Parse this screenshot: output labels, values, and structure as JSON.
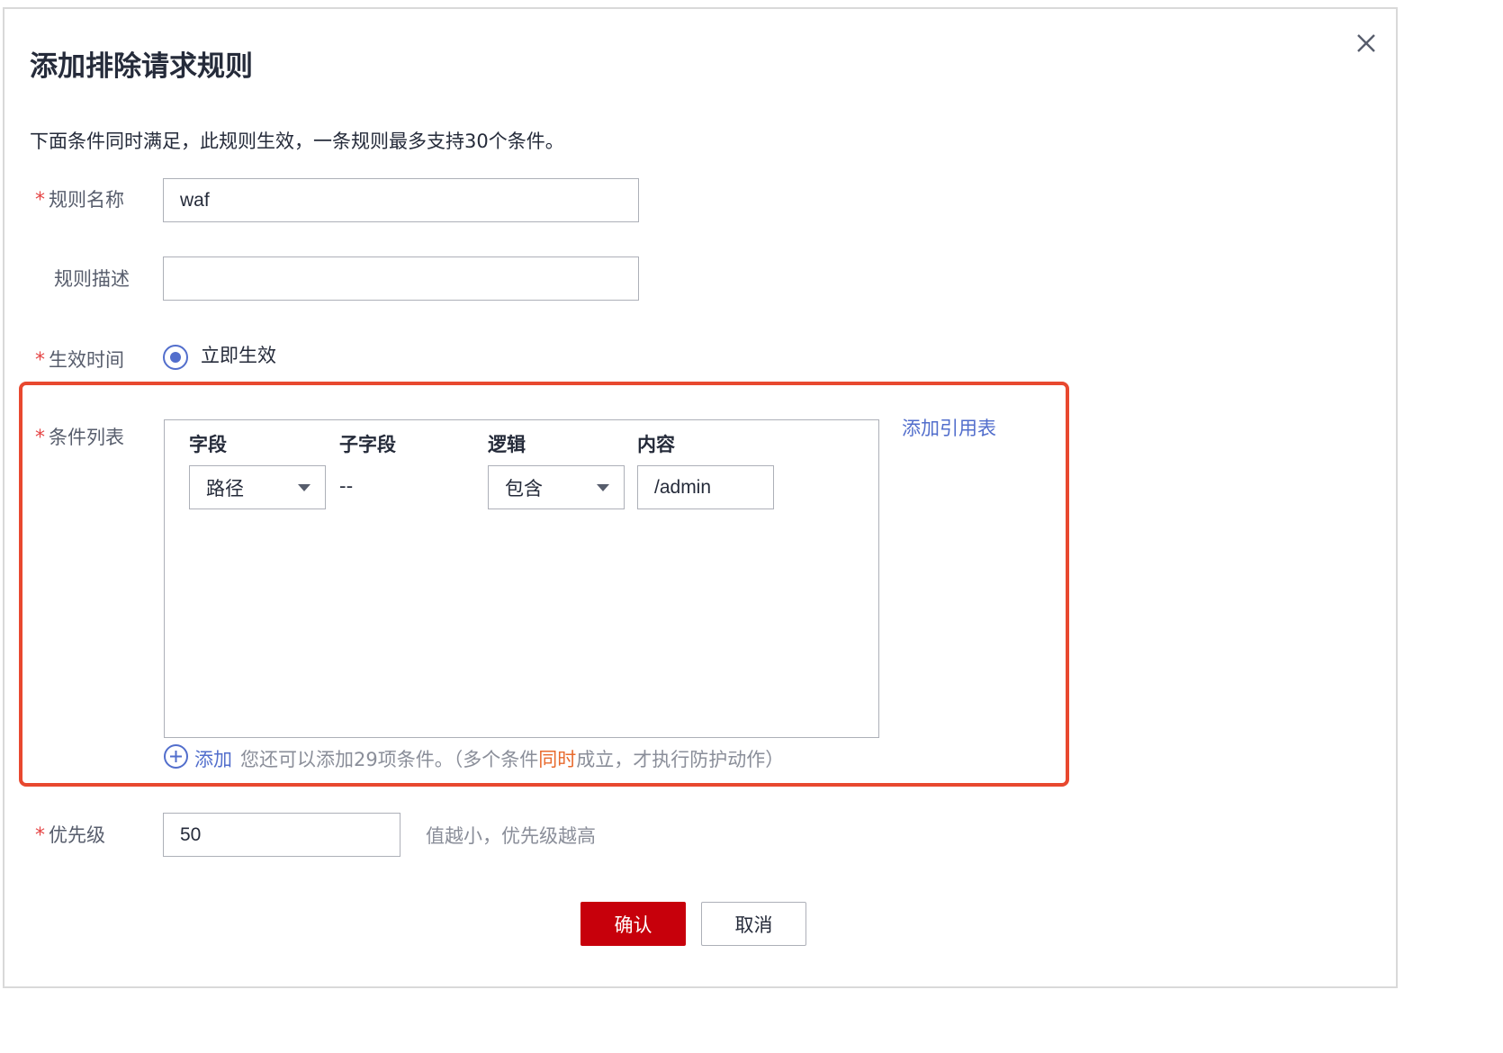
{
  "dialog": {
    "title": "添加排除请求规则",
    "description": "下面条件同时满足，此规则生效，一条规则最多支持30个条件。"
  },
  "form": {
    "required_mark": "*",
    "rule_name": {
      "label": "规则名称",
      "value": "waf"
    },
    "rule_desc": {
      "label": "规则描述",
      "value": ""
    },
    "effective_time": {
      "label": "生效时间",
      "option": "立即生效",
      "selected": true
    },
    "conditions": {
      "label": "条件列表",
      "add_reference_table": "添加引用表",
      "columns": [
        "字段",
        "子字段",
        "逻辑",
        "内容"
      ],
      "row": {
        "field": "路径",
        "subfield": "--",
        "logic": "包含",
        "content": "/admin"
      },
      "add_label": "添加",
      "add_hint_prefix": "您还可以添加29项条件。（多个条件",
      "add_hint_highlight": "同时",
      "add_hint_suffix": "成立，才执行防护动作）"
    },
    "priority": {
      "label": "优先级",
      "value": "50",
      "hint": "值越小，优先级越高"
    }
  },
  "buttons": {
    "confirm": "确认",
    "cancel": "取消"
  },
  "colors": {
    "accent": "#526ecc",
    "primary_button": "#c7000b",
    "highlight_border": "#e8482f",
    "required": "#e54545",
    "emphasis": "#e86a2c"
  }
}
